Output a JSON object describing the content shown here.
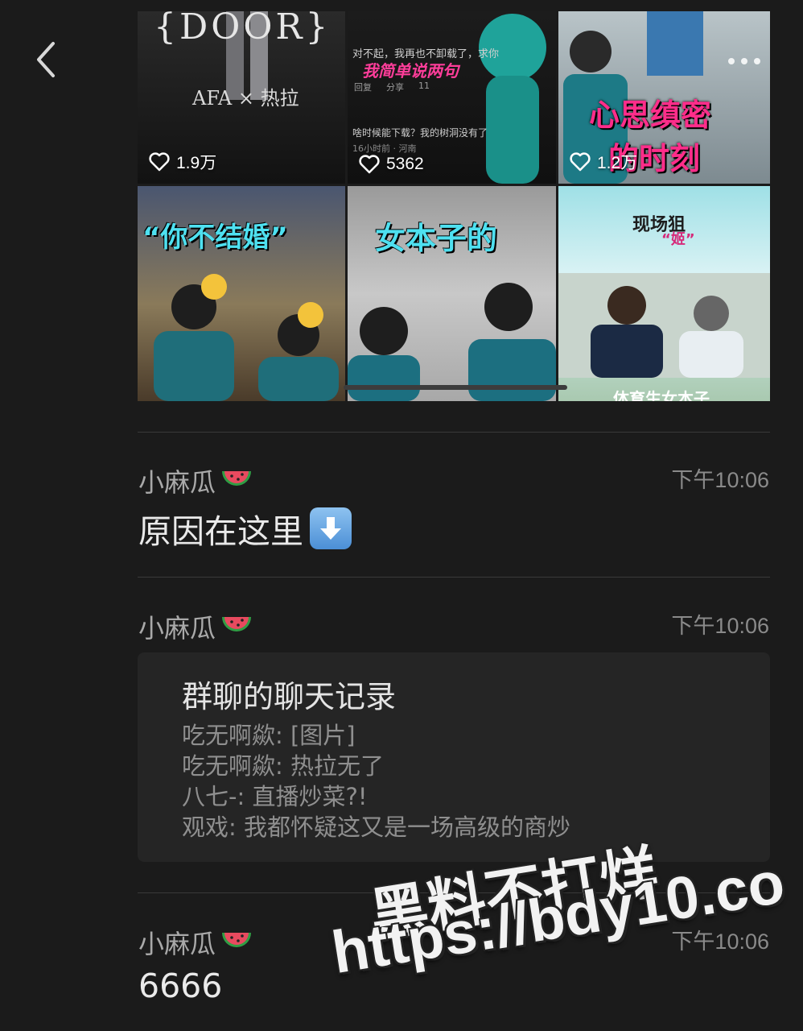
{
  "nav": {
    "back_icon": "chevron-left-icon"
  },
  "videos": [
    {
      "likes": "1.9万",
      "overlay_lines": [
        "{DOOR}",
        "AFA × 热拉"
      ]
    },
    {
      "likes": "5362",
      "overlay_lines": [
        "对不起，我再也不卸载了，求你",
        "我简单说两句",
        "回复",
        "分享",
        "11",
        "啥时候能下载？我的树洞没有了",
        "16小时前 · 河南"
      ]
    },
    {
      "likes": "1.2万",
      "overlay_lines": [
        "心思缜密",
        "的时刻"
      ]
    },
    {
      "likes": "",
      "overlay_lines": [
        "“你不结婚”"
      ]
    },
    {
      "likes": "",
      "overlay_lines": [
        "女本子的"
      ]
    },
    {
      "likes": "",
      "overlay_lines": [
        "现场狙",
        "“姬”",
        "体育生女本子"
      ]
    }
  ],
  "messages": [
    {
      "sender": "小麻瓜",
      "sender_emoji": "watermelon-icon",
      "time": "下午10:06",
      "text": "原因在这里",
      "text_emoji": "down-arrow-icon"
    },
    {
      "sender": "小麻瓜",
      "sender_emoji": "watermelon-icon",
      "time": "下午10:06",
      "card": {
        "title": "群聊的聊天记录",
        "lines": [
          "吃无啊歘: [图片]",
          "吃无啊歘: 热拉无了",
          "八七-: 直播炒菜?!",
          "观戏: 我都怀疑这又是一场高级的商炒"
        ]
      }
    },
    {
      "sender": "小麻瓜",
      "sender_emoji": "watermelon-icon",
      "time": "下午10:06",
      "text": "6666"
    }
  ],
  "watermark": {
    "line1": "黑料不打烊",
    "line2": "https://bdy10.co"
  },
  "colors": {
    "background": "#1b1b1b",
    "card": "#252525",
    "divider": "#3a3a3a"
  }
}
